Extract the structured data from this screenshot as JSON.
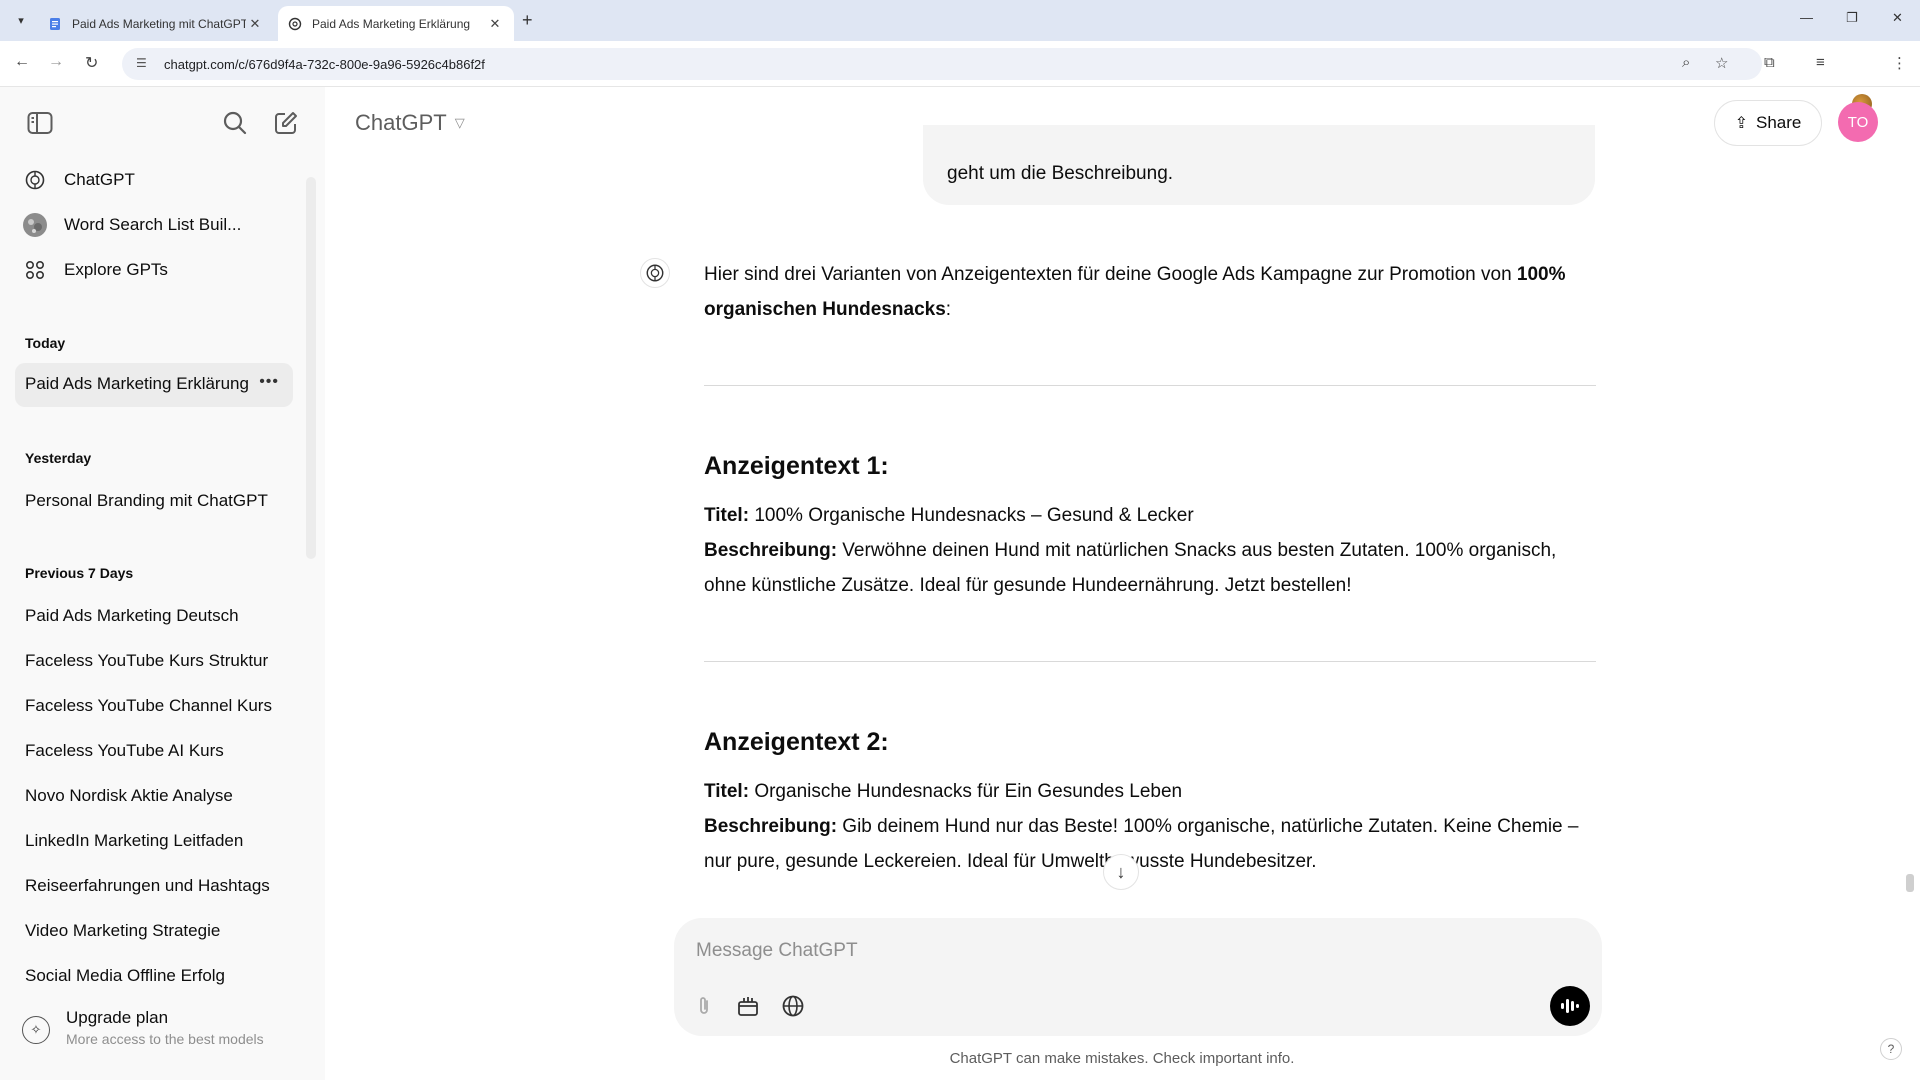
{
  "browser": {
    "tabs": [
      {
        "title": "Paid Ads Marketing mit ChatGPT",
        "active": false
      },
      {
        "title": "Paid Ads Marketing Erklärung",
        "active": true
      }
    ],
    "url": "chatgpt.com/c/676d9f4a-732c-800e-9a96-5926c4b86f2f"
  },
  "sidebar": {
    "top_links": [
      {
        "label": "ChatGPT",
        "icon": "chatgpt-logo-icon"
      },
      {
        "label": "Word Search List Buil...",
        "icon": "gpt-avatar-icon"
      },
      {
        "label": "Explore GPTs",
        "icon": "grid-icon"
      }
    ],
    "sections": [
      {
        "title": "Today",
        "items": [
          "Paid Ads Marketing Erklärung"
        ]
      },
      {
        "title": "Yesterday",
        "items": [
          "Personal Branding mit ChatGPT"
        ]
      },
      {
        "title": "Previous 7 Days",
        "items": [
          "Paid Ads Marketing Deutsch",
          "Faceless YouTube Kurs Struktur",
          "Faceless YouTube Channel Kurs",
          "Faceless YouTube AI Kurs",
          "Novo Nordisk Aktie Analyse",
          "LinkedIn Marketing Leitfaden",
          "Reiseerfahrungen und Hashtags",
          "Video Marketing Strategie",
          "Social Media Offline Erfolg"
        ]
      }
    ],
    "upgrade": {
      "title": "Upgrade plan",
      "subtitle": "More access to the best models"
    }
  },
  "header": {
    "model": "ChatGPT",
    "share_label": "Share",
    "avatar_initials": "TO"
  },
  "conversation": {
    "user_message_tail": "geht um die Beschreibung.",
    "intro_text": "Hier sind drei Varianten von Anzeigentexten für deine Google Ads Kampagne zur Promotion von ",
    "intro_bold": "100% organischen Hundesnacks",
    "intro_end": ":",
    "ads": [
      {
        "heading": "Anzeigentext 1:",
        "title_label": "Titel:",
        "title": " 100% Organische Hundesnacks – Gesund & Lecker",
        "desc_label": "Beschreibung:",
        "desc": " Verwöhne deinen Hund mit natürlichen Snacks aus besten Zutaten. 100% organisch, ohne künstliche Zusätze. Ideal für gesunde Hundeernährung. Jetzt bestellen!"
      },
      {
        "heading": "Anzeigentext 2:",
        "title_label": "Titel:",
        "title": " Organische Hundesnacks für Ein Gesundes Leben",
        "desc_label": "Beschreibung:",
        "desc": " Gib deinem Hund nur das Beste! 100% organische, natürliche Zutaten. Keine Chemie – nur pure, gesunde Leckereien. Ideal für Umweltbewusste Hundebesitzer."
      }
    ]
  },
  "composer": {
    "placeholder": "Message ChatGPT"
  },
  "footer": {
    "disclaimer": "ChatGPT can make mistakes. Check important info.",
    "help": "?"
  }
}
